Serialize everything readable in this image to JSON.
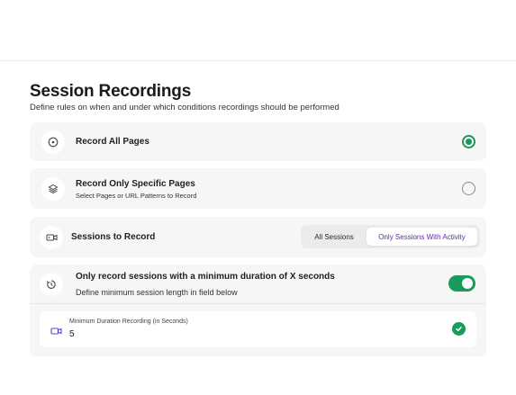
{
  "header": {
    "title": "Session Recordings",
    "subtitle": "Define rules on when and under which conditions recordings should be performed"
  },
  "options": {
    "record_all": {
      "label": "Record All Pages",
      "selected": true,
      "icon": "target-icon"
    },
    "record_specific": {
      "label": "Record Only Specific Pages",
      "sublabel": "Select Pages or URL Patterns to Record",
      "selected": false,
      "icon": "layers-icon"
    }
  },
  "sessions": {
    "label": "Sessions to Record",
    "icon": "video-icon",
    "choices": [
      "All Sessions",
      "Only Sessions With Activity"
    ],
    "selected": "Only Sessions With Activity"
  },
  "min_duration": {
    "label": "Only record sessions with a minimum duration of X seconds",
    "sublabel": "Define minimum session length in field below",
    "icon": "timer-icon",
    "enabled": true,
    "field_label": "Minimum Duration Recording (in Seconds)",
    "field_value": "5",
    "field_icon": "video-icon"
  },
  "colors": {
    "accent_green": "#1a9a5c",
    "accent_purple": "#5b2bb8"
  }
}
